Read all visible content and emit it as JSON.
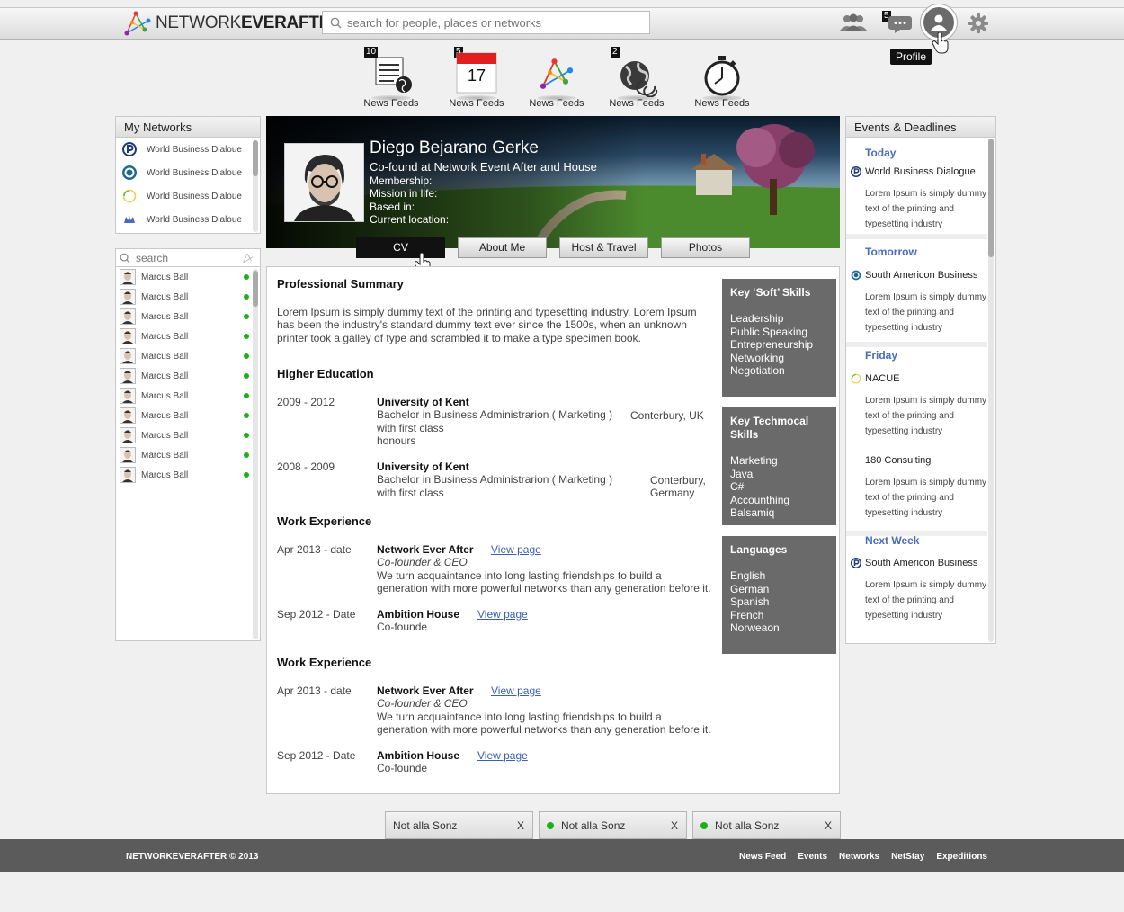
{
  "header": {
    "logo_light": "NETWORK",
    "logo_bold": "EVERAFTER",
    "search_placeholder": "search for people, places or networks",
    "messages_badge": "5",
    "profile_tooltip": "Profile"
  },
  "quick_nav": [
    {
      "label": "News Feeds",
      "badge": "10",
      "icon": "news-globe-icon"
    },
    {
      "label": "News Feeds",
      "badge": "5",
      "icon": "calendar-icon",
      "day": "17"
    },
    {
      "label": "News Feeds",
      "badge": "",
      "icon": "network-logo-icon"
    },
    {
      "label": "News Feeds",
      "badge": "2",
      "icon": "globe-icon"
    },
    {
      "label": "News Feeds",
      "badge": "",
      "icon": "stopwatch-icon"
    }
  ],
  "my_networks": {
    "title": "My Networks",
    "items": [
      {
        "label": "World Business Dialoue"
      },
      {
        "label": "World Business Dialoue"
      },
      {
        "label": "World Business Dialoue"
      },
      {
        "label": "World Business Dialoue"
      }
    ]
  },
  "contacts": {
    "search_placeholder": "search",
    "items": [
      "Marcus Ball",
      "Marcus Ball",
      "Marcus Ball",
      "Marcus Ball",
      "Marcus Ball",
      "Marcus Ball",
      "Marcus Ball",
      "Marcus Ball",
      "Marcus Ball",
      "Marcus Ball",
      "Marcus Ball"
    ]
  },
  "profile": {
    "name": "Diego Bejarano Gerke",
    "role": "Co-found at Network Event After and House",
    "membership": "Membership:",
    "mission": "Mission in life:",
    "based": "Based in:",
    "location": "Current location:"
  },
  "tabs": {
    "cv": "CV",
    "about": "About Me",
    "host": "Host & Travel",
    "photos": "Photos"
  },
  "cv": {
    "summary_title": "Professional Summary",
    "summary_text": [
      "Lorem Ipsum is simply dummy text of the printing and typesetting industry. Lorem Ipsum",
      "has been the industry's standard dummy text ever since the 1500s, when an unknown",
      "printer took a galley of type and scrambled it to make a type specimen book."
    ],
    "education_title": "Higher Education",
    "education": [
      {
        "years": "2009 - 2012",
        "school": "University of Kent",
        "degree": "Bachelor in Business Administrarion ( Marketing )",
        "line2": "with first class",
        "line3": "honours",
        "place": "Conterbury, UK"
      },
      {
        "years": "2008 - 2009",
        "school": "University of Kent",
        "degree": "Bachelor in Business Administrarion ( Marketing )",
        "line2": "with first class",
        "place1": "Conterbury,",
        "place2": "Germany"
      }
    ],
    "work_title": "Work Experience",
    "work": [
      {
        "dates": "Apr 2013 - date",
        "company": "Network Ever After",
        "link": "View page",
        "role": "Co-founder & CEO",
        "desc1": "We turn acquaintance into long lasting friendships to build a",
        "desc2": "generation with more powerful networks than any generation before it."
      },
      {
        "dates": "Sep 2012 - Date",
        "company": "Ambition House",
        "link": "View page",
        "role": "Co-founde"
      }
    ],
    "work_title2": "Work Experience",
    "work2": [
      {
        "dates": "Apr 2013 - date",
        "company": "Network Ever After",
        "link": "View page",
        "role": "Co-founder & CEO",
        "desc1": "We turn acquaintance into long lasting friendships to build a",
        "desc2": "generation with more powerful networks than any generation before it."
      },
      {
        "dates": "Sep 2012 - Date",
        "company": "Ambition House",
        "link": "View page",
        "role": "Co-founde"
      }
    ]
  },
  "skills": {
    "soft_title": "Key ‘Soft’ Skills",
    "soft": [
      "Leadership",
      "Public Speaking",
      "Entrepreneurship",
      "Networking",
      "Negotiation"
    ],
    "tech_title": "Key Techmocal Skills",
    "tech": [
      "Marketing",
      "Java",
      "C#",
      "Accounthing",
      "Balsamiq"
    ],
    "lang_title": "Languages",
    "lang": [
      "English",
      "German",
      "Spanish",
      "French",
      "Norweaon"
    ]
  },
  "events": {
    "title": "Events & Deadlines",
    "groups": [
      {
        "day": "Today",
        "title": "World Business Dialogue",
        "lines": [
          "Lorem Ipsum is simply dummy",
          "text of the printing and",
          "typesetting industry"
        ]
      },
      {
        "day": "Tomorrow",
        "title": "South Americon Business",
        "lines": [
          "Lorem Ipsum is simply dummy",
          "text of the printing and",
          "typesetting industry"
        ]
      },
      {
        "day": "Friday",
        "title": "NACUE",
        "lines": [
          "Lorem Ipsum is simply dummy",
          "text of the printing and",
          "typesetting industry"
        ]
      },
      {
        "day": "",
        "title": "180 Consulting",
        "lines": [
          "Lorem Ipsum is simply dummy",
          "text of the printing and",
          "typesetting industry"
        ]
      },
      {
        "day": "Next Week",
        "title": "South Americon Business",
        "lines": [
          "Lorem Ipsum is simply dummy",
          "text of the printing and",
          "typesetting industry"
        ]
      }
    ]
  },
  "chats": [
    {
      "name": "Not alla Sonz",
      "online": false,
      "close": "X"
    },
    {
      "name": "Not alla Sonz",
      "online": true,
      "close": "X"
    },
    {
      "name": "Not alla Sonz",
      "online": true,
      "close": "X"
    }
  ],
  "footer": {
    "copyright": "NETWORKEVERAFTER © 2013",
    "links": [
      "News Feed",
      "Events",
      "Networks",
      "NetStay",
      "Expeditions"
    ]
  }
}
